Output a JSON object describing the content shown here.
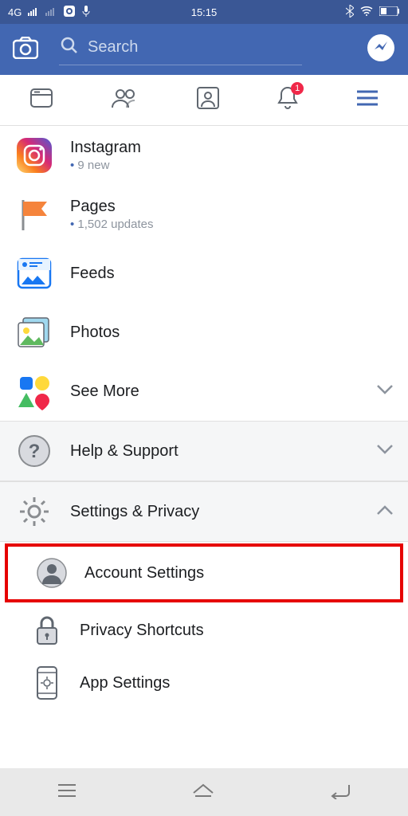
{
  "status": {
    "network": "4G",
    "time": "15:15"
  },
  "search": {
    "placeholder": "Search"
  },
  "tabs": {
    "notifications_badge": "1"
  },
  "menu": {
    "instagram": {
      "title": "Instagram",
      "sub": "9 new"
    },
    "pages": {
      "title": "Pages",
      "sub": "1,502 updates"
    },
    "feeds": {
      "title": "Feeds"
    },
    "photos": {
      "title": "Photos"
    },
    "see_more": {
      "title": "See More"
    },
    "help": {
      "title": "Help & Support"
    },
    "settings_privacy": {
      "title": "Settings & Privacy"
    },
    "account_settings": {
      "title": "Account Settings"
    },
    "privacy_shortcuts": {
      "title": "Privacy Shortcuts"
    },
    "app_settings": {
      "title": "App Settings"
    }
  }
}
